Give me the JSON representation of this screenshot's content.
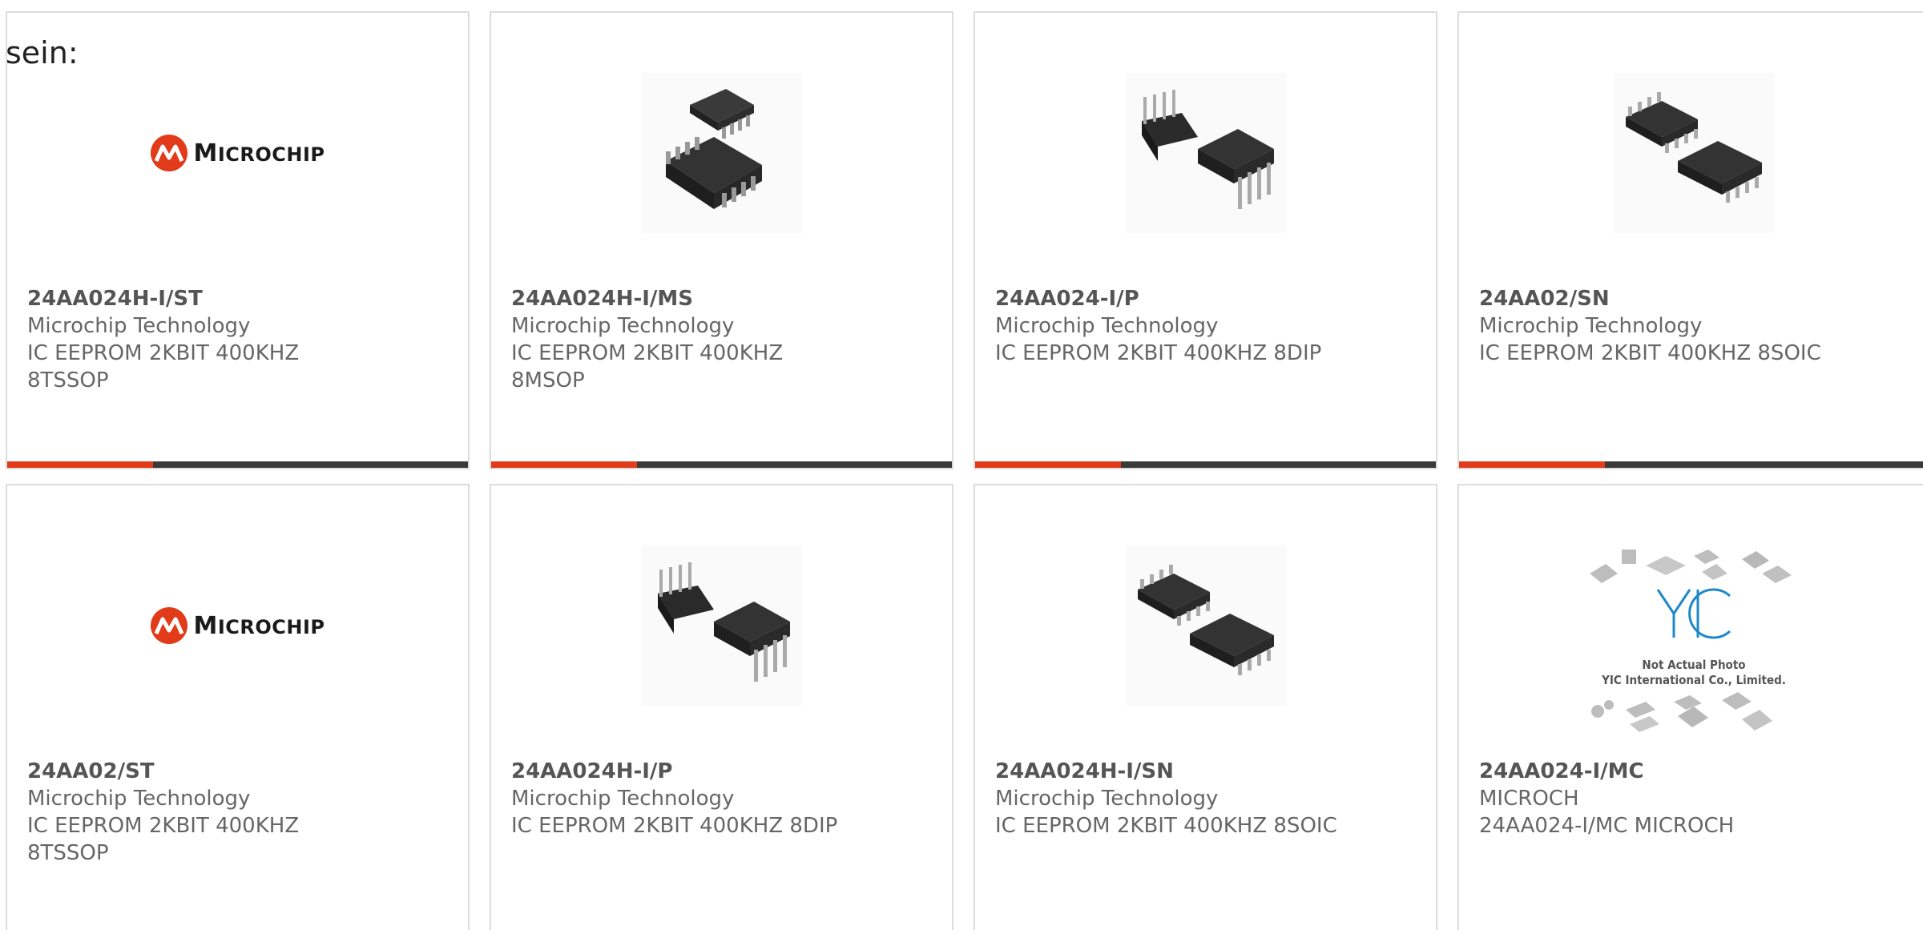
{
  "intro_text": "sein:",
  "colors": {
    "accent": "#e23b1a",
    "bar": "#3a3a3a",
    "border": "#dcdcdc",
    "text": "#666666"
  },
  "cards": [
    {
      "part": "24AA024H-I/ST",
      "maker": "Microchip Technology",
      "desc": "IC EEPROM 2KBIT 400KHZ 8TSSOP",
      "image": "microchip-logo"
    },
    {
      "part": "24AA024H-I/MS",
      "maker": "Microchip Technology",
      "desc": "IC EEPROM 2KBIT 400KHZ 8MSOP",
      "image": "msop-chip"
    },
    {
      "part": "24AA024-I/P",
      "maker": "Microchip Technology",
      "desc": "IC EEPROM 2KBIT 400KHZ 8DIP",
      "image": "dip-chip"
    },
    {
      "part": "24AA02/SN",
      "maker": "Microchip Technology",
      "desc": "IC EEPROM 2KBIT 400KHZ 8SOIC",
      "image": "soic-chip"
    },
    {
      "part": "24AA02/ST",
      "maker": "Microchip Technology",
      "desc": "IC EEPROM 2KBIT 400KHZ 8TSSOP",
      "image": "microchip-logo"
    },
    {
      "part": "24AA024H-I/P",
      "maker": "Microchip Technology",
      "desc": "IC EEPROM 2KBIT 400KHZ 8DIP",
      "image": "dip-chip"
    },
    {
      "part": "24AA024H-I/SN",
      "maker": "Microchip Technology",
      "desc": "IC EEPROM 2KBIT 400KHZ 8SOIC",
      "image": "soic-chip"
    },
    {
      "part": "24AA024-I/MC",
      "maker": "MICROCH",
      "desc": "24AA024-I/MC MICROCH",
      "image": "placeholder-photo"
    }
  ],
  "logo_text": {
    "big": "M",
    "rest": "ICROCHIP"
  },
  "placeholder": {
    "line1": "Not Actual Photo",
    "line2": "YIC International Co., Limited."
  }
}
